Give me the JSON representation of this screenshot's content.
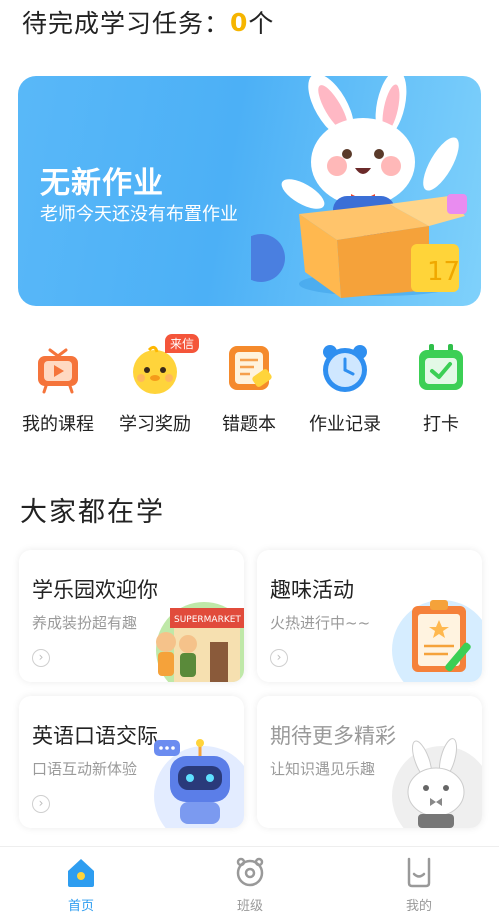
{
  "header": {
    "prefix": "待完成学习任务：",
    "count": "0",
    "suffix": "个"
  },
  "banner": {
    "title": "无新作业",
    "subtitle": "老师今天还没有布置作业"
  },
  "quick_actions": [
    {
      "label": "我的课程",
      "icon": "course-tv-icon"
    },
    {
      "label": "学习奖励",
      "icon": "reward-chick-icon",
      "badge": "来信"
    },
    {
      "label": "错题本",
      "icon": "mistake-book-icon"
    },
    {
      "label": "作业记录",
      "icon": "alarm-clock-icon"
    },
    {
      "label": "打卡",
      "icon": "checkin-calendar-icon"
    }
  ],
  "section": {
    "title": "大家都在学"
  },
  "cards": [
    {
      "title": "学乐园欢迎你",
      "subtitle": "养成装扮超有趣",
      "art_text": "SUPERMARKET"
    },
    {
      "title": "趣味活动",
      "subtitle": "火热进行中~~"
    },
    {
      "title": "英语口语交际",
      "subtitle": "口语互动新体验"
    },
    {
      "title": "期待更多精彩",
      "subtitle": "让知识遇见乐趣"
    }
  ],
  "tabbar": [
    {
      "label": "首页",
      "active": true
    },
    {
      "label": "班级",
      "active": false
    },
    {
      "label": "我的",
      "active": false
    }
  ],
  "colors": {
    "accent": "#2e9df0",
    "count": "#f6b500",
    "banner": "#59b8f8",
    "badge": "#f4553a"
  }
}
